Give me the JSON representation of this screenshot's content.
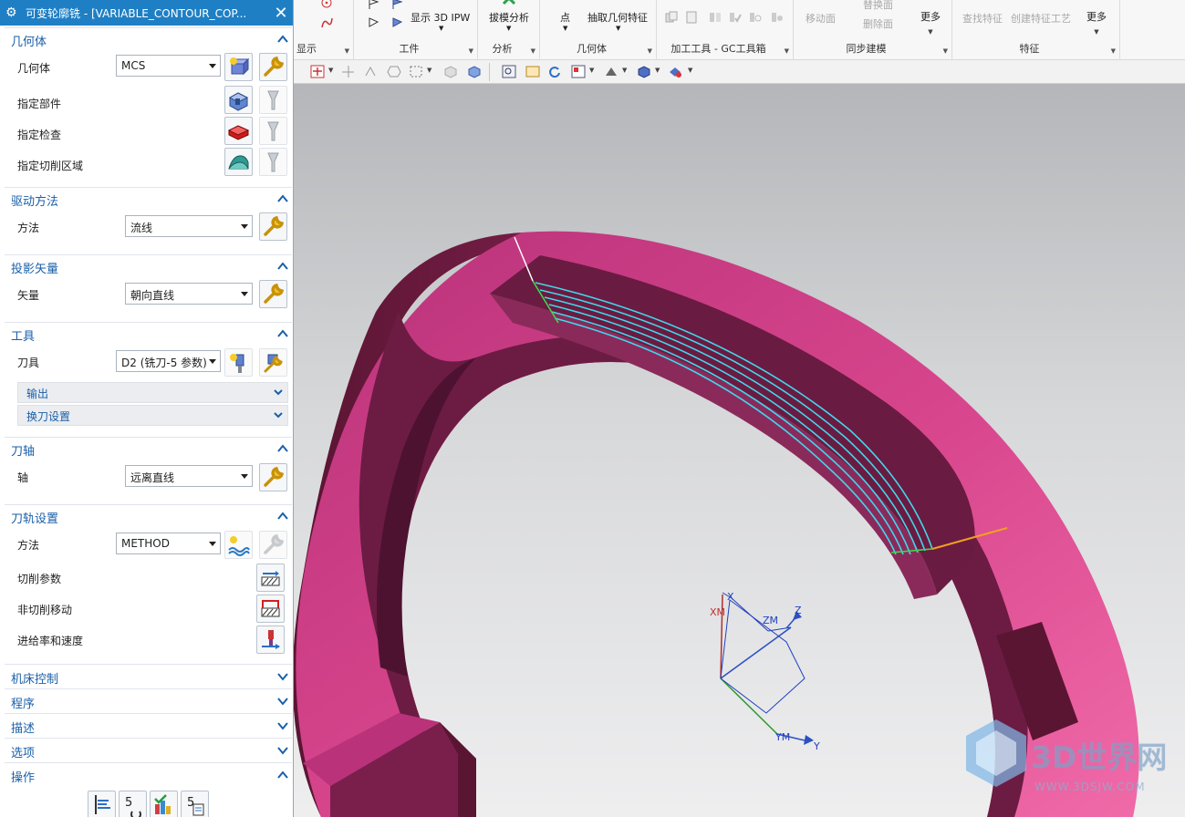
{
  "dialog": {
    "title": "可变轮廓铣 - [VARIABLE_CONTOUR_COP...",
    "geometry": {
      "header": "几何体",
      "geometry_label": "几何体",
      "geometry_value": "MCS",
      "specify_part": "指定部件",
      "specify_check": "指定检查",
      "specify_cut_area": "指定切削区域"
    },
    "drive_method": {
      "header": "驱动方法",
      "method_label": "方法",
      "method_value": "流线"
    },
    "projection_vector": {
      "header": "投影矢量",
      "vector_label": "矢量",
      "vector_value": "朝向直线"
    },
    "tool": {
      "header": "工具",
      "tool_label": "刀具",
      "tool_value": "D2 (铣刀-5 参数)",
      "output": "输出",
      "tool_change": "换刀设置"
    },
    "tool_axis": {
      "header": "刀轴",
      "axis_label": "轴",
      "axis_value": "远离直线"
    },
    "path_settings": {
      "header": "刀轨设置",
      "method_label": "方法",
      "method_value": "METHOD",
      "cut_params": "切削参数",
      "non_cut_moves": "非切削移动",
      "feeds_speeds": "进给率和速度"
    },
    "collapsed": [
      "机床控制",
      "程序",
      "描述",
      "选项"
    ],
    "actions": {
      "header": "操作"
    }
  },
  "ribbon": {
    "show_group": "显示",
    "workpiece": {
      "show_3d_ipw": "显示 3D IPW",
      "label": "工件"
    },
    "analysis": {
      "draft_analysis": "拔模分析",
      "label": "分析"
    },
    "geometry": {
      "point": "点",
      "extract_feature": "抽取几何特征",
      "label": "几何体"
    },
    "machining_tools": {
      "label": "加工工具 - GC工具箱"
    },
    "sync_modeling": {
      "move_face": "移动面",
      "replace_face": "替换面",
      "delete_face": "删除面",
      "more": "更多",
      "label": "同步建模"
    },
    "features": {
      "find_feature": "查找特征",
      "create_feature_process": "创建特征工艺",
      "more": "更多",
      "label": "特征"
    }
  },
  "viewport": {
    "csys_labels": {
      "xm": "XM",
      "x": "X",
      "zm": "ZM",
      "z": "Z",
      "ym": "YM",
      "y": "Y"
    },
    "watermark": {
      "brand": "3D世界网",
      "url": "WWW.3DSJW.COM"
    }
  },
  "colors": {
    "part": "#7e1f4d",
    "part_highlight": "#e0559a",
    "toolpath": "#3fd8ea",
    "title_bar": "#1f7fc4",
    "section_header": "#1a5fa8"
  }
}
